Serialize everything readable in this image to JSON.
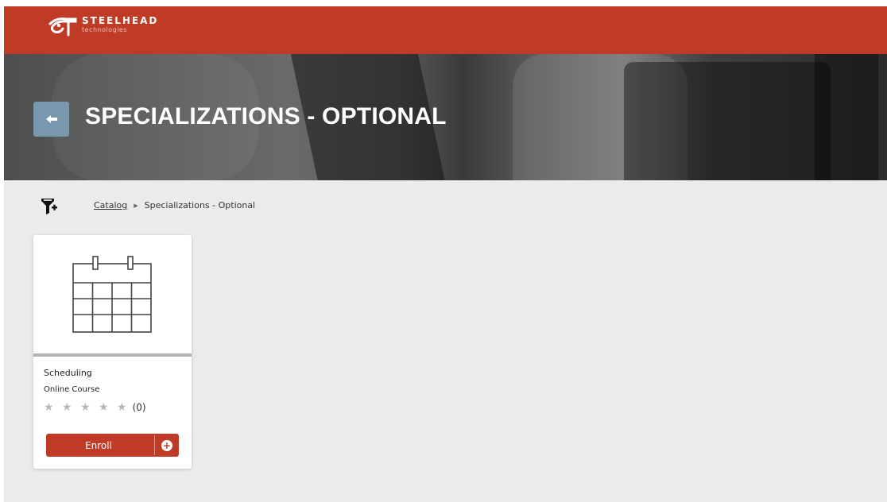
{
  "brand": {
    "name": "STEELHEAD",
    "sub": "technologies",
    "color": "#bf3b25"
  },
  "header": {
    "title": "SPECIALIZATIONS - OPTIONAL",
    "back_icon": "back-arrow-icon",
    "back_color": "#7a98ad"
  },
  "breadcrumb": {
    "filter_icon": "filter-plus-icon",
    "items": [
      "Catalog",
      "Specializations - Optional"
    ],
    "separator_icon": "caret-right-icon"
  },
  "courses": [
    {
      "image_icon": "calendar-icon",
      "title": "Scheduling",
      "type": "Online Course",
      "stars": "★ ★ ★ ★ ★",
      "rating_value": 0,
      "rating_count": "(0)",
      "enroll_label": "Enroll",
      "enroll_icon": "plus-circle-icon"
    }
  ]
}
